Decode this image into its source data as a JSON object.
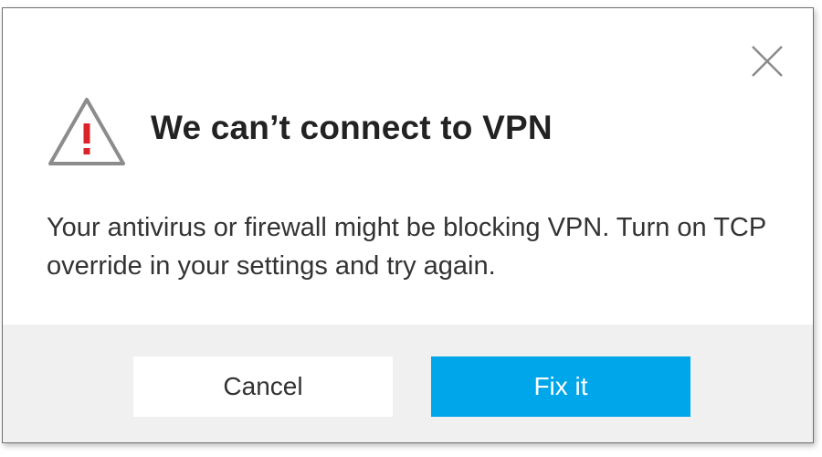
{
  "dialog": {
    "title": "We can’t connect to VPN",
    "message": "Your antivirus or firewall might be blocking VPN. Turn on TCP override in your settings and try again.",
    "icon": "warning-triangle-icon",
    "close_icon": "close-icon"
  },
  "buttons": {
    "cancel_label": "Cancel",
    "fix_label": "Fix it"
  },
  "colors": {
    "primary_button": "#00a6ea",
    "warning_mark": "#d9252a",
    "footer_bg": "#f0f0f0"
  }
}
